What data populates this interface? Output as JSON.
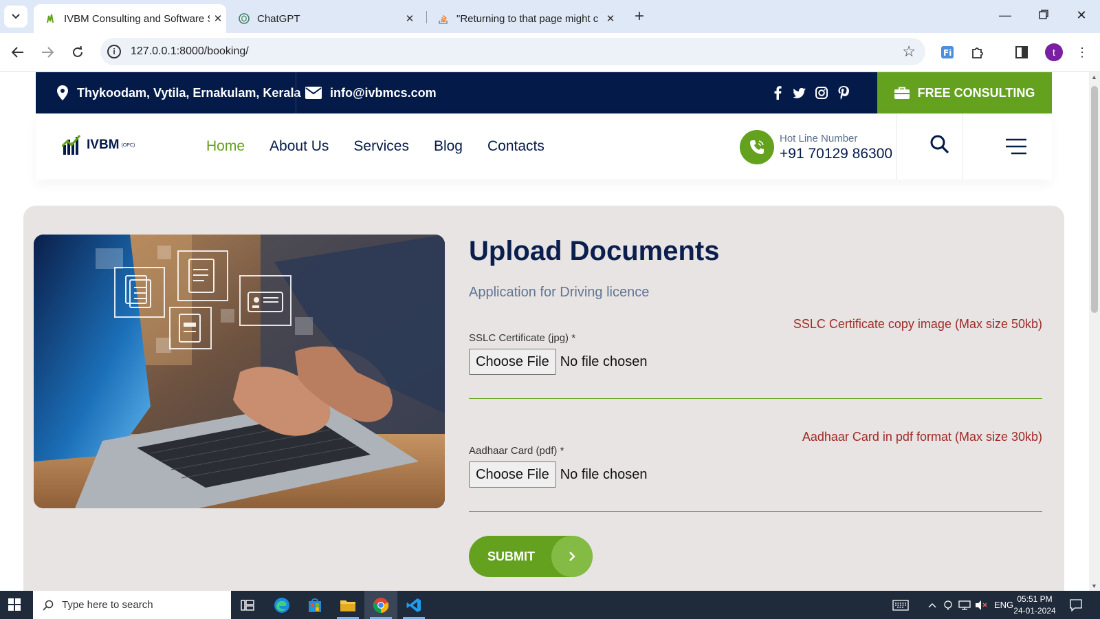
{
  "browser": {
    "tabs": [
      {
        "title": "IVBM Consulting and Software S",
        "active": true
      },
      {
        "title": "ChatGPT",
        "active": false
      },
      {
        "title": "\"Returning to that page might c",
        "active": false
      }
    ],
    "url": "127.0.0.1:8000/booking/",
    "profile_initial": "t"
  },
  "topbar": {
    "address": "Thykoodam, Vytila, Ernakulam, Kerala",
    "email": "info@ivbmcs.com",
    "cta": "FREE CONSULTING"
  },
  "header": {
    "logo_text": "IVBM",
    "logo_sub": "(OPC)",
    "nav": [
      {
        "label": "Home",
        "current": true
      },
      {
        "label": "About Us",
        "current": false
      },
      {
        "label": "Services",
        "current": false
      },
      {
        "label": "Blog",
        "current": false
      },
      {
        "label": "Contacts",
        "current": false
      }
    ],
    "hotline_label": "Hot Line Number",
    "hotline_number": "+91 70129 86300"
  },
  "form": {
    "title": "Upload Documents",
    "subtitle": "Application for Driving licence",
    "fields": [
      {
        "hint": "SSLC Certificate copy image (Max size 50kb)",
        "label": "SSLC Certificate (jpg) *",
        "button": "Choose File",
        "status": "No file chosen"
      },
      {
        "hint": "Aadhaar Card in pdf format (Max size 30kb)",
        "label": "Aadhaar Card (pdf) *",
        "button": "Choose File",
        "status": "No file chosen"
      }
    ],
    "submit": "SUBMIT"
  },
  "taskbar": {
    "search_placeholder": "Type here to search",
    "language": "ENG",
    "time": "05:51 PM",
    "date": "24-01-2024"
  },
  "colors": {
    "navy": "#041a49",
    "green": "#63a11e",
    "hint_red": "#9e2b25",
    "card_bg": "#e8e4e4"
  }
}
